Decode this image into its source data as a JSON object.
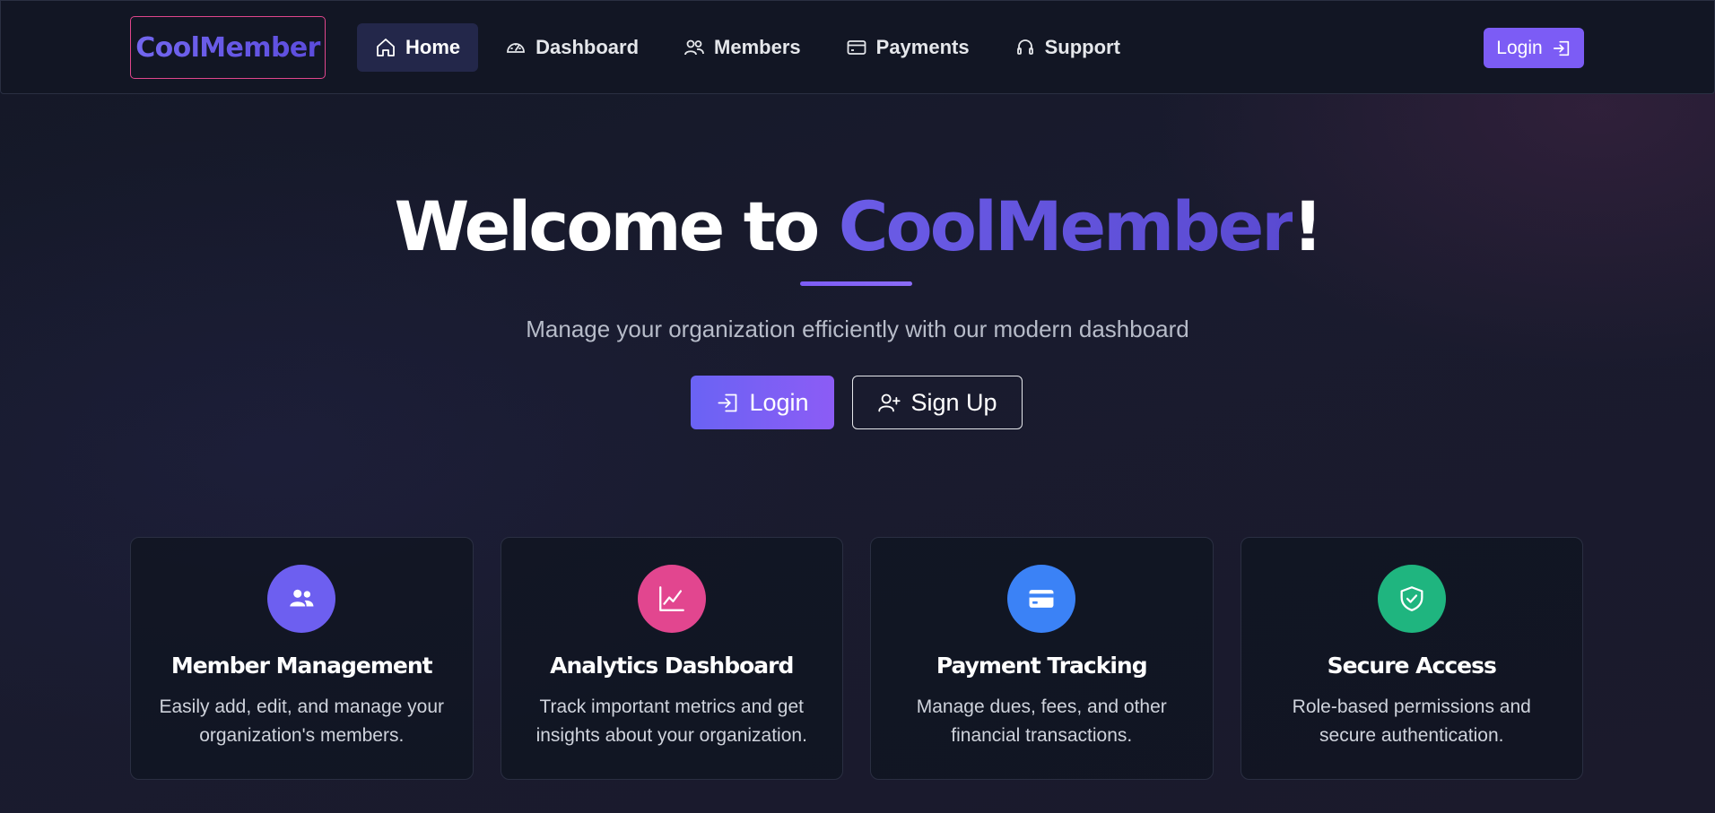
{
  "brand": "CoolMember",
  "nav": {
    "items": [
      {
        "label": "Home",
        "icon": "home-icon",
        "active": true
      },
      {
        "label": "Dashboard",
        "icon": "speedometer-icon",
        "active": false
      },
      {
        "label": "Members",
        "icon": "users-icon",
        "active": false
      },
      {
        "label": "Payments",
        "icon": "credit-card-icon",
        "active": false
      },
      {
        "label": "Support",
        "icon": "headset-icon",
        "active": false
      }
    ],
    "login_label": "Login"
  },
  "hero": {
    "title_prefix": "Welcome to ",
    "title_accent": "CoolMember",
    "title_suffix": "!",
    "subtitle": "Manage your organization efficiently with our modern dashboard",
    "login_label": "Login",
    "signup_label": "Sign Up"
  },
  "features": [
    {
      "title": "Member Management",
      "description": "Easily add, edit, and manage your organization's members.",
      "icon": "people-icon",
      "color": "#6d5ff0"
    },
    {
      "title": "Analytics Dashboard",
      "description": "Track important metrics and get insights about your organization.",
      "icon": "graph-icon",
      "color": "#e2468f"
    },
    {
      "title": "Payment Tracking",
      "description": "Manage dues, fees, and other financial transactions.",
      "icon": "card-icon",
      "color": "#3b82f6"
    },
    {
      "title": "Secure Access",
      "description": "Role-based permissions and secure authentication.",
      "icon": "shield-check-icon",
      "color": "#1fb57f"
    }
  ],
  "colors": {
    "accent": "#7c5cf5",
    "brand_border": "#e0468c",
    "background": "#181b2d"
  }
}
